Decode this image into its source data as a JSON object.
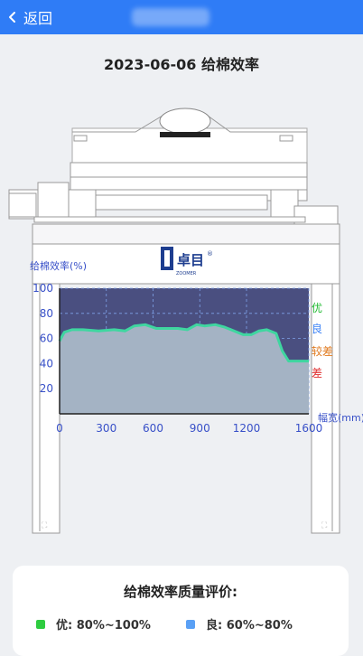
{
  "topbar": {
    "back_label": "返回"
  },
  "page": {
    "title": "2023-06-06 给棉效率"
  },
  "brand": {
    "logo_text": "卓目",
    "logo_sub": "ZOOMER"
  },
  "chart_data": {
    "type": "area",
    "ylabel": "给棉效率(%)",
    "xlabel": "幅宽(mm)",
    "x_ticks": [
      0,
      300,
      600,
      900,
      1200,
      1600
    ],
    "y_ticks": [
      20,
      40,
      60,
      80,
      100
    ],
    "xlim": [
      0,
      1600
    ],
    "ylim": [
      0,
      100
    ],
    "series": [
      {
        "x": [
          0,
          30,
          80,
          150,
          250,
          350,
          420,
          480,
          550,
          620,
          680,
          760,
          820,
          880,
          930,
          1000,
          1060,
          1120,
          1180,
          1230,
          1280,
          1330,
          1390,
          1430,
          1470,
          1520,
          1600
        ],
        "values": [
          58,
          65,
          67,
          67,
          66,
          67,
          66,
          70,
          71,
          68,
          68,
          68,
          67,
          71,
          70,
          71,
          69,
          66,
          63,
          63,
          66,
          67,
          64,
          50,
          42,
          42,
          42
        ]
      }
    ],
    "grade_labels": [
      {
        "label": "优",
        "color": "#22bb33"
      },
      {
        "label": "良",
        "color": "#3b82f6"
      },
      {
        "label": "较差",
        "color": "#e07a1f"
      },
      {
        "label": "差",
        "color": "#e03030"
      }
    ],
    "colors": {
      "area": "#a4b3c4",
      "line": "#3fd6a0",
      "plot_bg": "#4a4f80"
    }
  },
  "evaluation": {
    "title": "给棉效率质量评价:",
    "items": [
      {
        "label": "优: 80%~100%",
        "color": "#2ecc40"
      },
      {
        "label": "良: 60%~80%",
        "color": "#5aa0f5"
      }
    ]
  }
}
